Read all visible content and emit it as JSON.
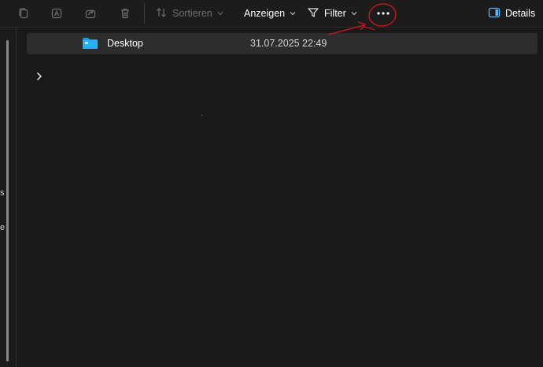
{
  "toolbar": {
    "copy_icon": "copy-icon",
    "rename_icon": "rename-icon",
    "share_icon": "share-icon",
    "delete_icon": "trash-icon",
    "sort_label": "Sortieren",
    "view_label": "Anzeigen",
    "filter_label": "Filter",
    "more_icon": "more-ellipsis-icon",
    "details_label": "Details"
  },
  "file_list": {
    "items": [
      {
        "name": "Desktop",
        "modified": "31.07.2025 22:49",
        "icon": "folder-icon",
        "selected": true
      }
    ]
  },
  "annotation": {
    "color": "#d4141e",
    "target": "more-ellipsis-icon"
  },
  "colors": {
    "background": "#191919",
    "row_selected": "#2d2d2d",
    "folder_blue": "#1f9be0",
    "disabled_text": "#6e6e6e"
  }
}
